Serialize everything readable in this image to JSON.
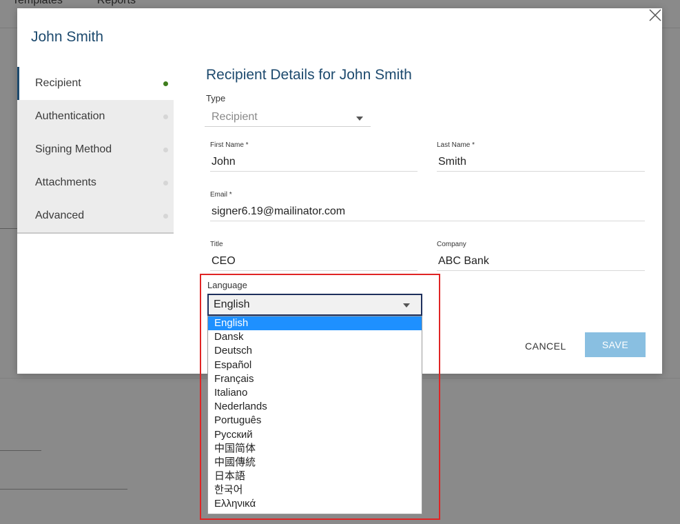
{
  "background": {
    "nav": [
      "Templates",
      "Reports"
    ]
  },
  "modal": {
    "title": "John Smith",
    "sidebar": [
      {
        "label": "Recipient",
        "active": true
      },
      {
        "label": "Authentication",
        "active": false
      },
      {
        "label": "Signing Method",
        "active": false
      },
      {
        "label": "Attachments",
        "active": false
      },
      {
        "label": "Advanced",
        "active": false
      }
    ],
    "section_title": "Recipient Details for John Smith",
    "type": {
      "label": "Type",
      "value": "Recipient"
    },
    "first_name": {
      "label": "First Name *",
      "value": "John"
    },
    "last_name": {
      "label": "Last Name *",
      "value": "Smith"
    },
    "email": {
      "label": "Email *",
      "value": "signer6.19@mailinator.com"
    },
    "title_field": {
      "label": "Title",
      "value": "CEO"
    },
    "company": {
      "label": "Company",
      "value": "ABC Bank"
    },
    "language": {
      "label": "Language",
      "value": "English",
      "options": [
        "English",
        "Dansk",
        "Deutsch",
        "Español",
        "Français",
        "Italiano",
        "Nederlands",
        "Português",
        "Русский",
        "中国简体",
        "中國傳統",
        "日本語",
        "한국어",
        "Ελληνικά"
      ]
    },
    "cancel_label": "CANCEL",
    "save_label": "SAVE"
  },
  "colors": {
    "accent": "#1d4a6e",
    "save": "#89bfe1",
    "highlight": "#e02424",
    "selected_option": "#1e90ff"
  }
}
